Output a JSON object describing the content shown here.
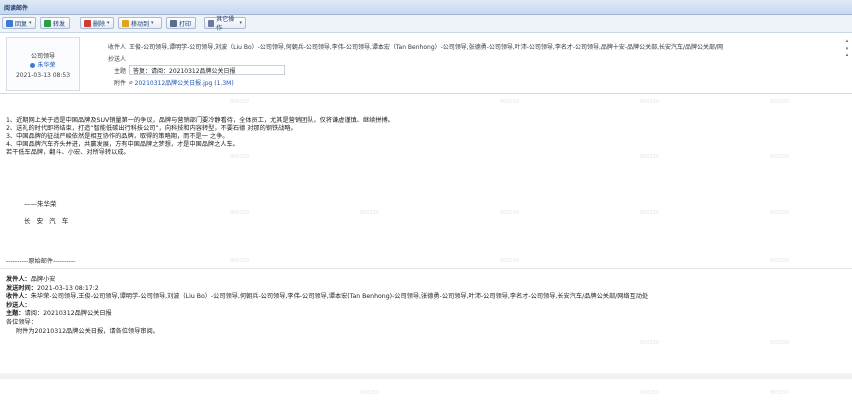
{
  "window": {
    "title": "阅读邮件"
  },
  "toolbar": {
    "buttons": [
      {
        "label": "回复",
        "color": "#3a7bd5",
        "dropdown": true
      },
      {
        "label": "转发",
        "color": "#2e9c48",
        "dropdown": false
      },
      {
        "label": "删除",
        "color": "#d23b2f",
        "dropdown": true
      },
      {
        "label": "移动到",
        "color": "#e2a21a",
        "dropdown": true
      },
      {
        "label": "打印",
        "color": "#5a6e8c",
        "dropdown": false
      },
      {
        "label": "其它操作",
        "color": "#6b7a99",
        "dropdown": true
      }
    ]
  },
  "sender": {
    "org": "公司领导",
    "name": "朱华荣",
    "time": "2021-03-13 08:53"
  },
  "header": {
    "to_label": "收件人",
    "to_value": "王俊-公司领导,谭明学-公司领导,刘波（Liu Bo）-公司领导,何朝兵-公司领导,李伟-公司领导,谭本宏（Tan Benhong）-公司领导,张德勇-公司领导,叶沛-公司领导,李名才-公司领导,品牌十安-品牌公关部,长安汽车/品牌公关部/网",
    "cc_label": "抄送人",
    "cc_value": "",
    "subject_label": "主题",
    "subject_value": "答复：请阅：20210312品牌公关日报",
    "attach_label": "附件",
    "attach_value": "20210312品牌公关日报.jpg (1.3M)"
  },
  "body": {
    "lines": [
      "1、近期网上关于造是中国品牌及SUV销量第一的争议，品牌与营销部门要冷静看待，全体员工，尤其是营销团队，仅将谦虚谨慎、继续拼搏。",
      "2、送礼的时代即将结束，打造“智能低碳出行科技公司”，向科技和内容转型，不要石德 对那的钢铁战略。",
      "3、中国品牌的征战严峻依然是相互协作的品牌，取得的策略期，而不是一 之争。",
      "4、中国品牌汽车齐头并进，共赢发展，方有中国品牌之梦想，才是中国品牌之人车。",
      "若干低车品牌，翻斗、小宏、对所导转以成。"
    ],
    "signature_dash": "——朱华荣",
    "signature_chars": "长 安 汽 车"
  },
  "original": {
    "divider": "----------原始邮件----------",
    "from_label": "发件人：",
    "from_value": "品牌小安",
    "sent_label": "发送时间：",
    "sent_value": "2021-03-13 08:17:2",
    "to_label": "收件人：",
    "to_value": "朱华荣-公司领导,王俊-公司领导,谭明学-公司领导,刘波（Liu Bo）-公司领导,何朝兵-公司领导,李伟-公司领导,谭本宏(Tan Benhong)-公司领导,张德勇-公司领导,叶沛-公司领导,李名才-公司领导,长安汽车/品牌公关部/网络互动处",
    "cc_label": "抄送人：",
    "subject_label": "主题：",
    "subject_value": "请阅：20210312品牌公关日报",
    "greeting": "各位领导：",
    "content": "附件为20210312品牌公关日报，请各位领导审阅。"
  },
  "watermark": "800250"
}
